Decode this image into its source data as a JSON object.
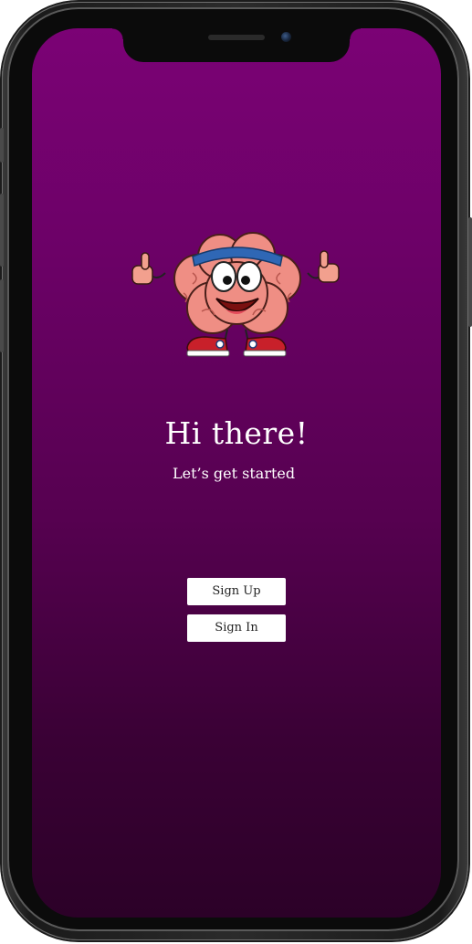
{
  "welcome": {
    "greeting": "Hi there!",
    "subtitle": "Let’s get started"
  },
  "actions": {
    "sign_up_label": "Sign Up",
    "sign_in_label": "Sign In"
  },
  "mascot": {
    "icon": "brain-mascot-icon"
  },
  "colors": {
    "background_top": "#7b0275",
    "background_bottom": "#2c0128",
    "button_bg": "#ffffff",
    "text": "#ffffff"
  }
}
